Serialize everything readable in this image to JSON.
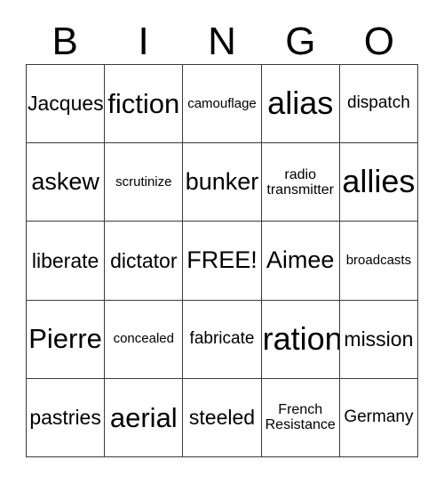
{
  "card": {
    "header_letters": [
      "B",
      "I",
      "N",
      "G",
      "O"
    ],
    "free_space_label": "FREE!",
    "colors": {
      "background": "#ffffff",
      "text": "#000000",
      "grid_line": "#3a3a3a"
    },
    "rows": [
      [
        {
          "text": "Jacques",
          "size": "md"
        },
        {
          "text": "fiction",
          "size": "xl"
        },
        {
          "text": "camouflage",
          "size": "xs"
        },
        {
          "text": "alias",
          "size": "xxl"
        },
        {
          "text": "dispatch",
          "size": "sm"
        }
      ],
      [
        {
          "text": "askew",
          "size": "lg"
        },
        {
          "text": "scrutinize",
          "size": "xs"
        },
        {
          "text": "bunker",
          "size": "lg"
        },
        {
          "text": "radio\ntransmitter",
          "size": "two"
        },
        {
          "text": "allies",
          "size": "xxl"
        }
      ],
      [
        {
          "text": "liberate",
          "size": "md"
        },
        {
          "text": "dictator",
          "size": "md"
        },
        {
          "text": "FREE!",
          "size": "lg"
        },
        {
          "text": "Aimee",
          "size": "lg"
        },
        {
          "text": "broadcasts",
          "size": "xs"
        }
      ],
      [
        {
          "text": "Pierre",
          "size": "xl"
        },
        {
          "text": "concealed",
          "size": "xs"
        },
        {
          "text": "fabricate",
          "size": "sm"
        },
        {
          "text": "ration",
          "size": "xxl"
        },
        {
          "text": "mission",
          "size": "md"
        }
      ],
      [
        {
          "text": "pastries",
          "size": "md"
        },
        {
          "text": "aerial",
          "size": "xl"
        },
        {
          "text": "steeled",
          "size": "md"
        },
        {
          "text": "French\nResistance",
          "size": "two"
        },
        {
          "text": "Germany",
          "size": "sm"
        }
      ]
    ]
  }
}
